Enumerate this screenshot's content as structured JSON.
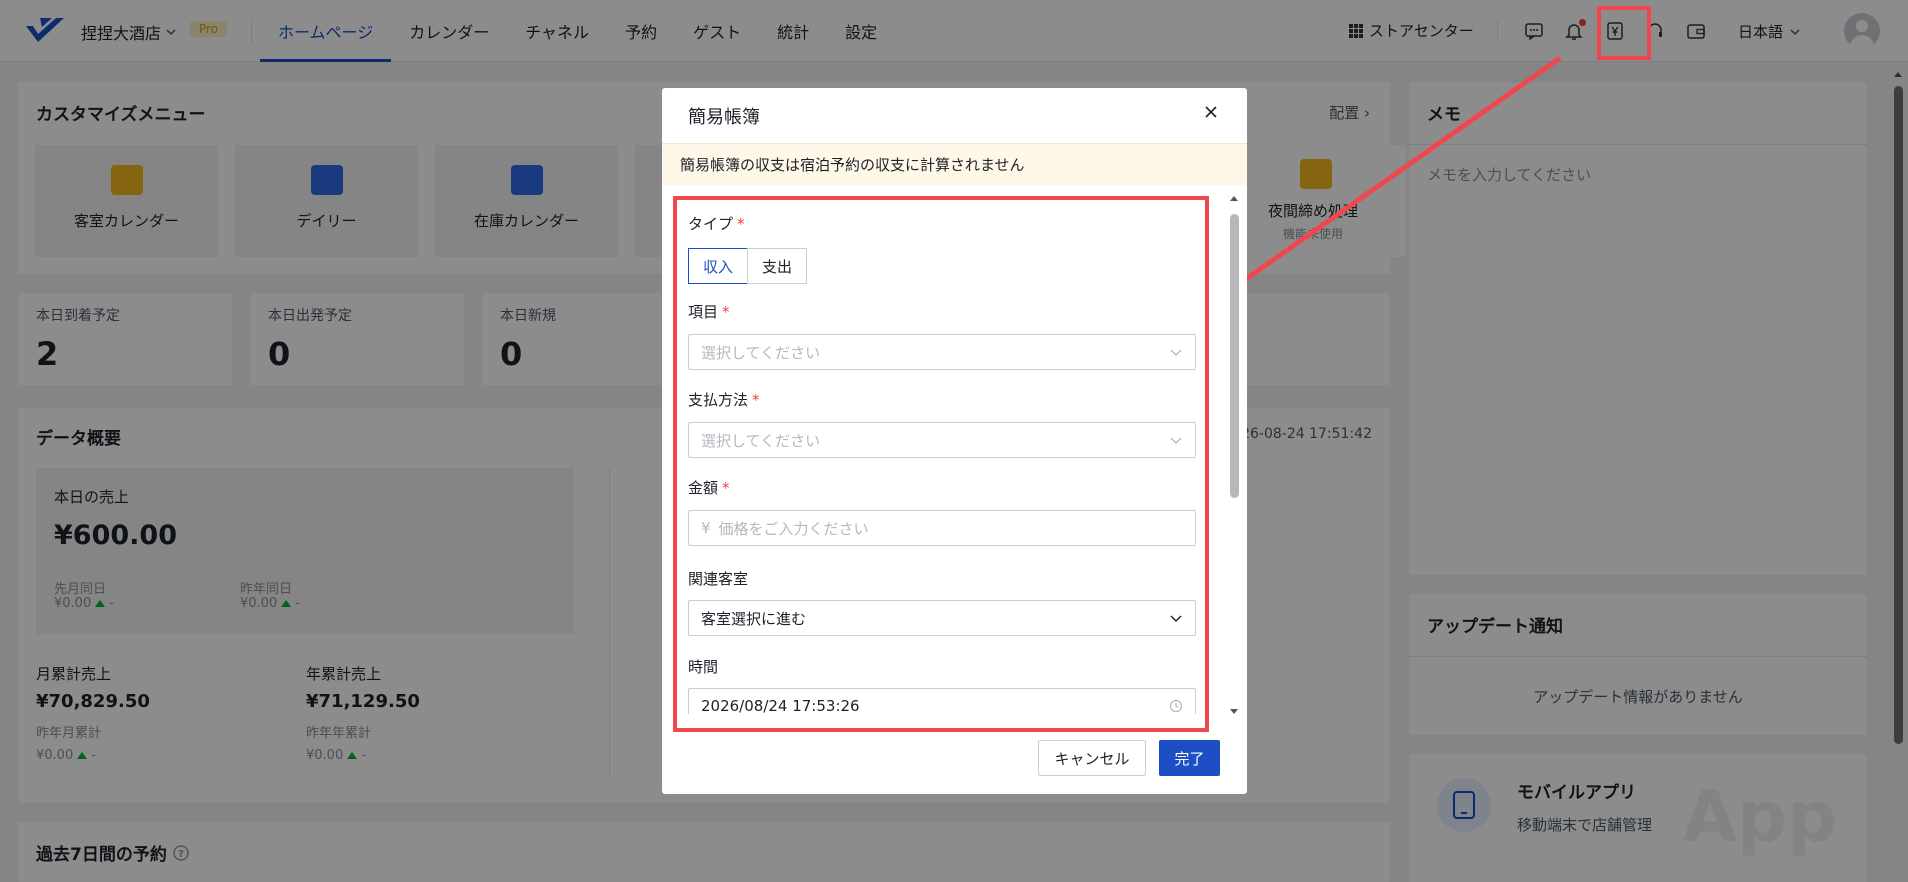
{
  "header": {
    "hotel_name": "捏捏大酒店",
    "pro_badge": "Pro",
    "nav": [
      "ホームページ",
      "カレンダー",
      "チャネル",
      "予約",
      "ゲスト",
      "統計",
      "設定"
    ],
    "active_nav": "ホームページ",
    "store_center": "ストアセンター",
    "language": "日本語",
    "icons": [
      "message-icon",
      "bell-icon",
      "yen-ledger-icon",
      "headset-icon",
      "wallet-icon"
    ]
  },
  "custom_menu": {
    "title": "カスタマイズメニュー",
    "config": "配置",
    "tiles": [
      "客室カレンダー",
      "デイリー",
      "在庫カレンダー"
    ],
    "night_audit": "夜間締め処理",
    "night_audit_sub": "機能未使用"
  },
  "stats": [
    {
      "label": "本日到着予定",
      "value": "2"
    },
    {
      "label": "本日出発予定",
      "value": "0"
    },
    {
      "label": "本日新規",
      "value": "0"
    }
  ],
  "overview": {
    "title": "データ概要",
    "timestamp": "2026-08-24 17:51:42",
    "today_sales_label": "本日の売上",
    "today_sales": "¥600.00",
    "last_month_label": "先月同日",
    "last_month_value": "¥0.00",
    "last_year_label": "昨年同日",
    "last_year_value": "¥0.00",
    "monthly_label": "月累計売上",
    "monthly_value": "¥70,829.50",
    "monthly_prev_label": "昨年月累計",
    "monthly_prev_value": "¥0.00",
    "yearly_label": "年累計売上",
    "yearly_value": "¥71,129.50",
    "yearly_prev_label": "昨年年累計",
    "yearly_prev_value": "¥0.00",
    "dash": "-"
  },
  "past7": {
    "title": "過去7日間の予約"
  },
  "memo": {
    "title": "メモ",
    "placeholder": "メモを入力してください"
  },
  "updates": {
    "title": "アップデート通知",
    "empty": "アップデート情報がありません"
  },
  "mobile": {
    "title": "モバイルアプリ",
    "subtitle": "移動端末で店舗管理",
    "watermark": "App"
  },
  "modal": {
    "title": "簡易帳簿",
    "notice": "簡易帳簿の収支は宿泊予約の収支に計算されません",
    "type_label": "タイプ",
    "type_options": [
      "収入",
      "支出"
    ],
    "type_selected": "収入",
    "item_label": "項目",
    "item_placeholder": "選択してください",
    "payment_label": "支払方法",
    "payment_placeholder": "選択してください",
    "amount_label": "金額",
    "amount_prefix": "¥",
    "amount_placeholder": "価格をご入力ください",
    "room_label": "関連客室",
    "room_value": "客室選択に進む",
    "time_label": "時間",
    "time_value": "2026/08/24 17:53:26",
    "required_mark": "*",
    "cancel": "キャンセル",
    "ok": "完了"
  },
  "colors": {
    "primary": "#1d4fc4",
    "highlight": "#f0474f",
    "notice_bg": "#fff7e8"
  }
}
